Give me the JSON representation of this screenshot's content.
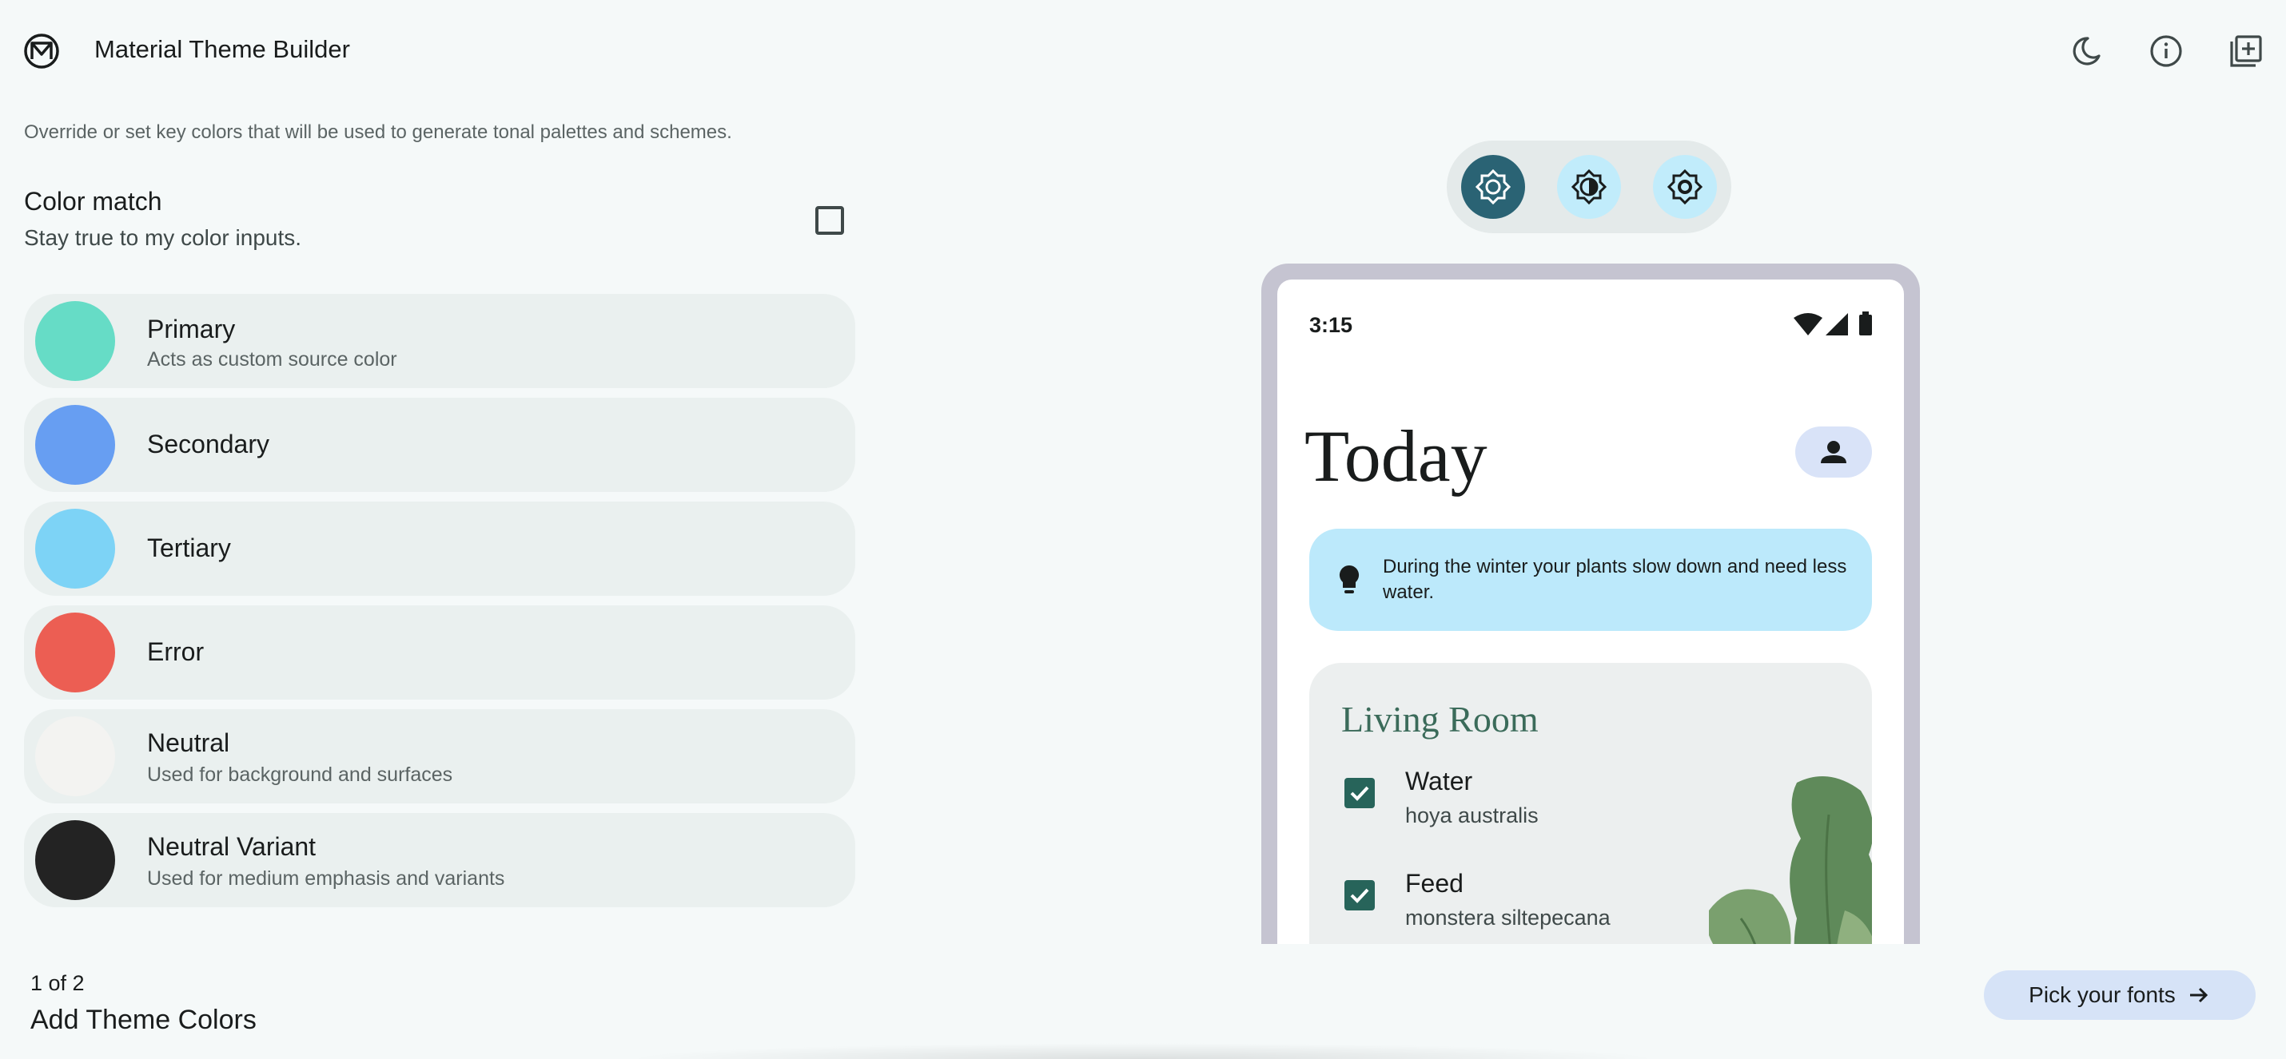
{
  "app": {
    "title": "Material Theme Builder"
  },
  "header": {
    "icons": [
      "material-logo-icon",
      "dark-mode-icon",
      "info-icon",
      "add-to-library-icon"
    ]
  },
  "left_panel": {
    "intro": "Override or set key colors that will be used to generate tonal palettes and schemes.",
    "color_match": {
      "title": "Color match",
      "subtitle": "Stay true to my color inputs.",
      "checked": false
    },
    "colors": [
      {
        "name": "Primary",
        "desc": "Acts as custom source color",
        "color": "#66dcc6"
      },
      {
        "name": "Secondary",
        "desc": "",
        "color": "#679ef2"
      },
      {
        "name": "Tertiary",
        "desc": "",
        "color": "#7dd3f6"
      },
      {
        "name": "Error",
        "desc": "",
        "color": "#ec5e53"
      },
      {
        "name": "Neutral",
        "desc": "Used for background and surfaces",
        "color": "#f3f3f1"
      },
      {
        "name": "Neutral Variant",
        "desc": "Used for medium emphasis and variants",
        "color": "#232323"
      }
    ],
    "step": "1 of 2",
    "step_title": "Add Theme Colors"
  },
  "actions": {
    "next_label": "Pick your fonts"
  },
  "mode_switch": {
    "options": [
      "light",
      "contrast",
      "dark"
    ],
    "selected": "light",
    "colors": {
      "selected": "#2a6374",
      "unselected": "#c1ecfb"
    }
  },
  "phone": {
    "time": "3:15",
    "heading": "Today",
    "tip": "During the winter your plants slow down and need less water.",
    "card": {
      "title": "Living Room",
      "tasks": [
        {
          "name": "Water",
          "plant": "hoya australis",
          "checked": true
        },
        {
          "name": "Feed",
          "plant": "monstera siltepecana",
          "checked": true
        }
      ]
    }
  }
}
